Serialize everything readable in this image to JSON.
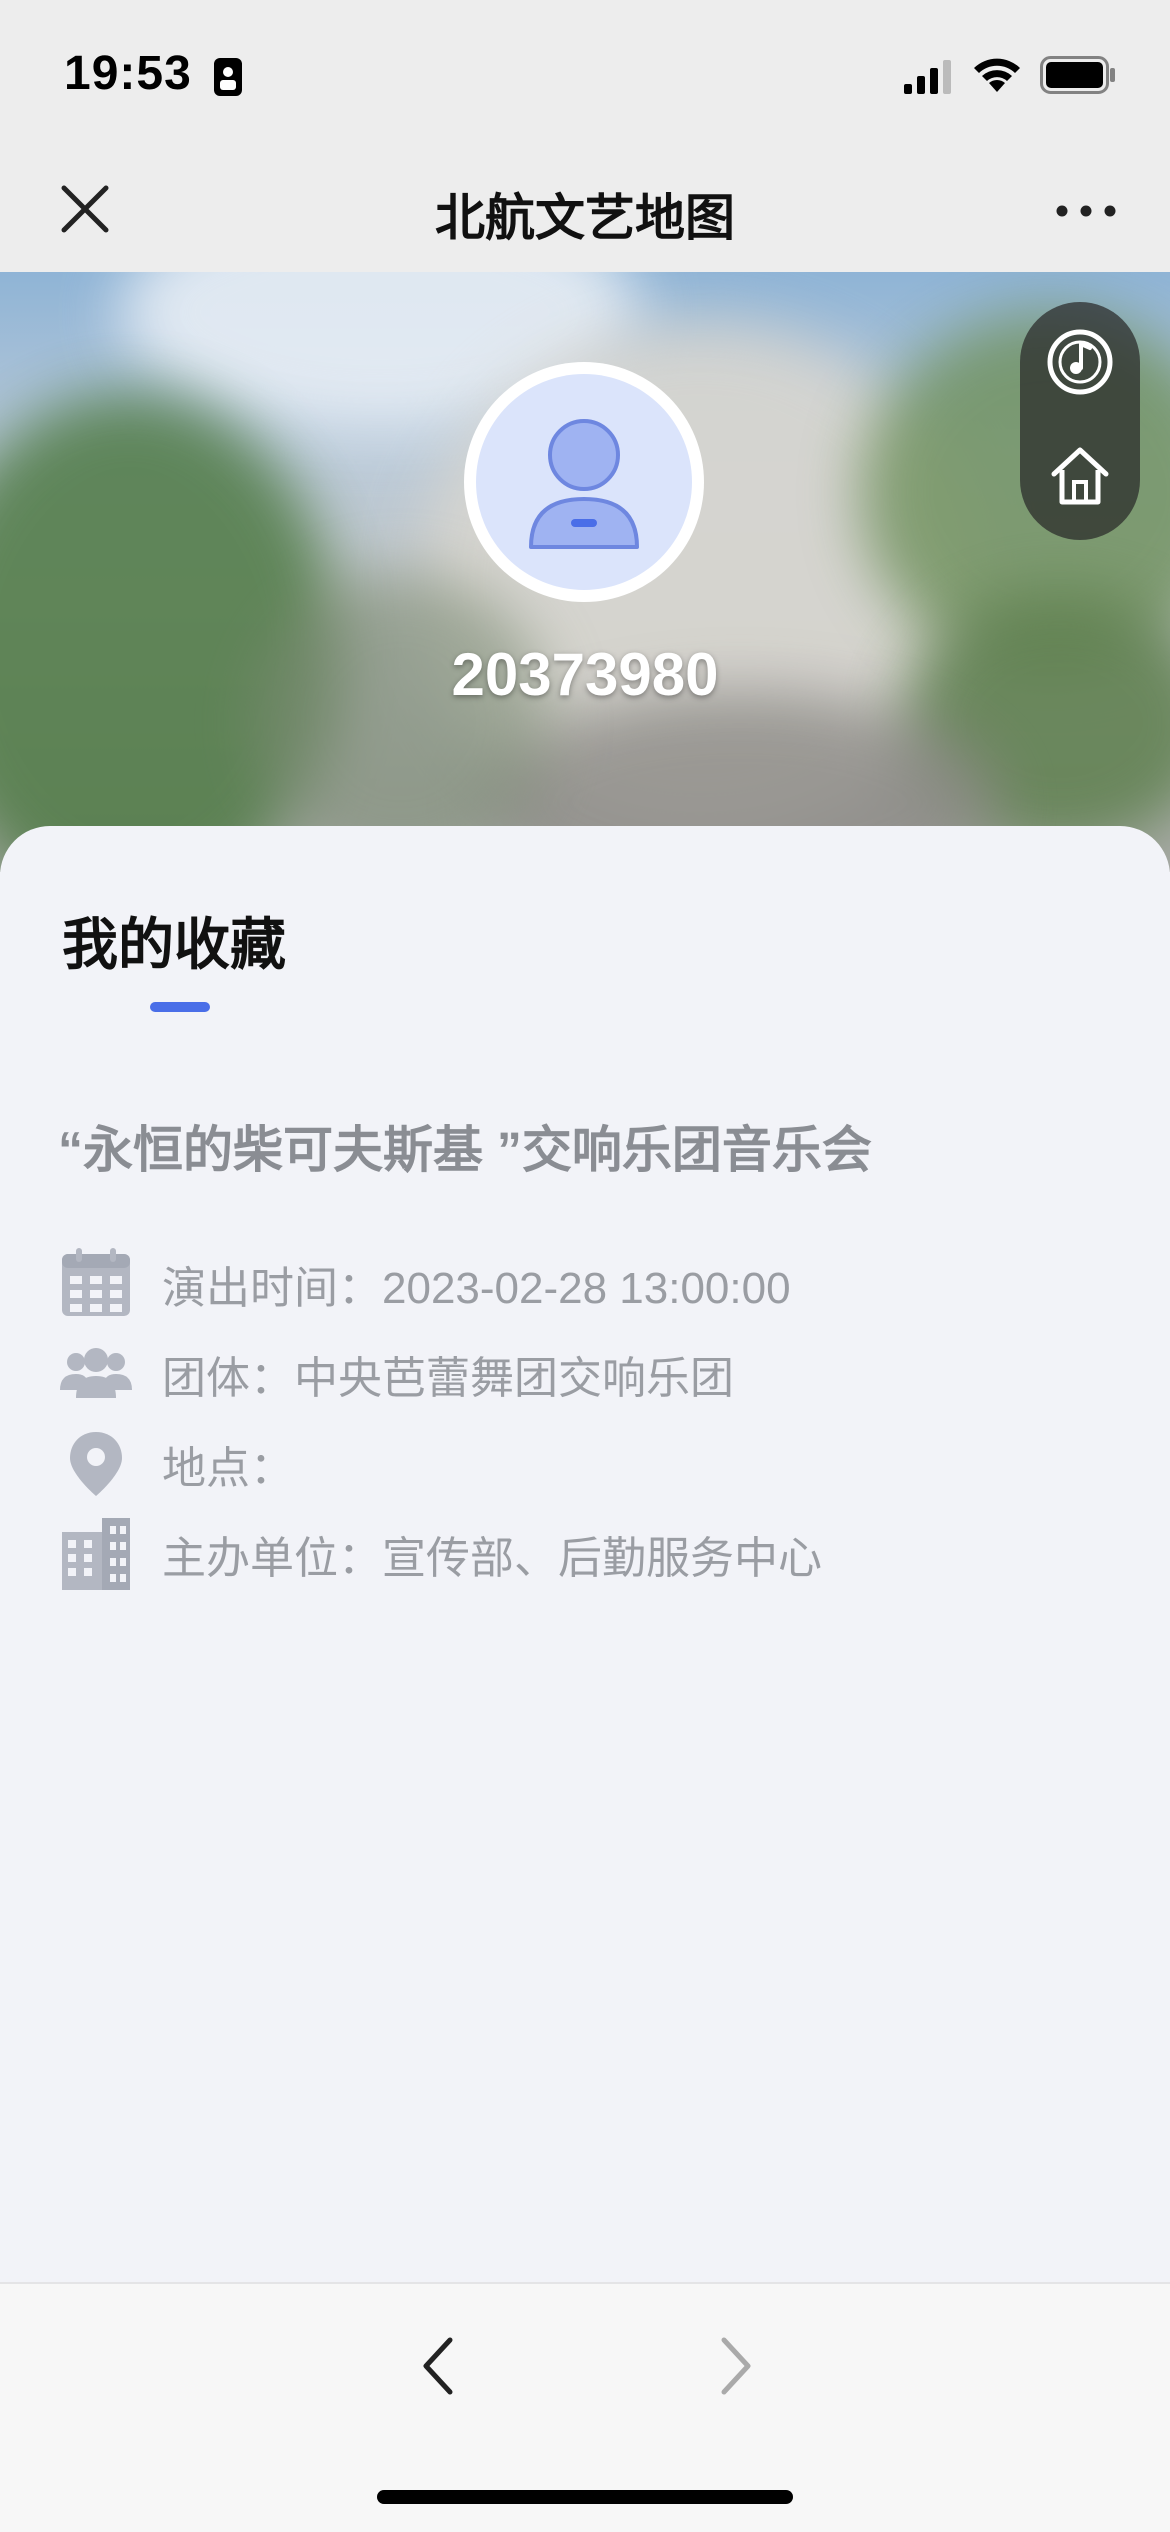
{
  "status_bar": {
    "time": "19:53",
    "icons": [
      "lock-icon",
      "signal-icon",
      "wifi-icon",
      "battery-icon"
    ]
  },
  "nav": {
    "title": "北航文艺地图",
    "close_icon": "close-icon",
    "more_icon": "more-icon"
  },
  "hero": {
    "user_id": "20373980",
    "side_buttons": [
      "music-icon",
      "home-icon"
    ]
  },
  "favorites": {
    "section_title": "我的收藏",
    "event": {
      "title": "“永恒的柴可夫斯基 ”交响乐团音乐会",
      "time": "演出时间：2023-02-28 13:00:00",
      "group": "团体：中央芭蕾舞团交响乐团",
      "location": "地点：",
      "organizer": "主办单位：宣传部、后勤服务中心"
    }
  },
  "bottom_nav": {
    "back_icon": "chevron-left-icon",
    "forward_icon": "chevron-right-icon"
  },
  "colors": {
    "accent": "#4a6ee8",
    "muted_text": "#9a9da3",
    "icon_gray": "#b3b7c2",
    "avatar_bg": "#dbe4fb",
    "avatar_figure": "#8fa6f0"
  }
}
